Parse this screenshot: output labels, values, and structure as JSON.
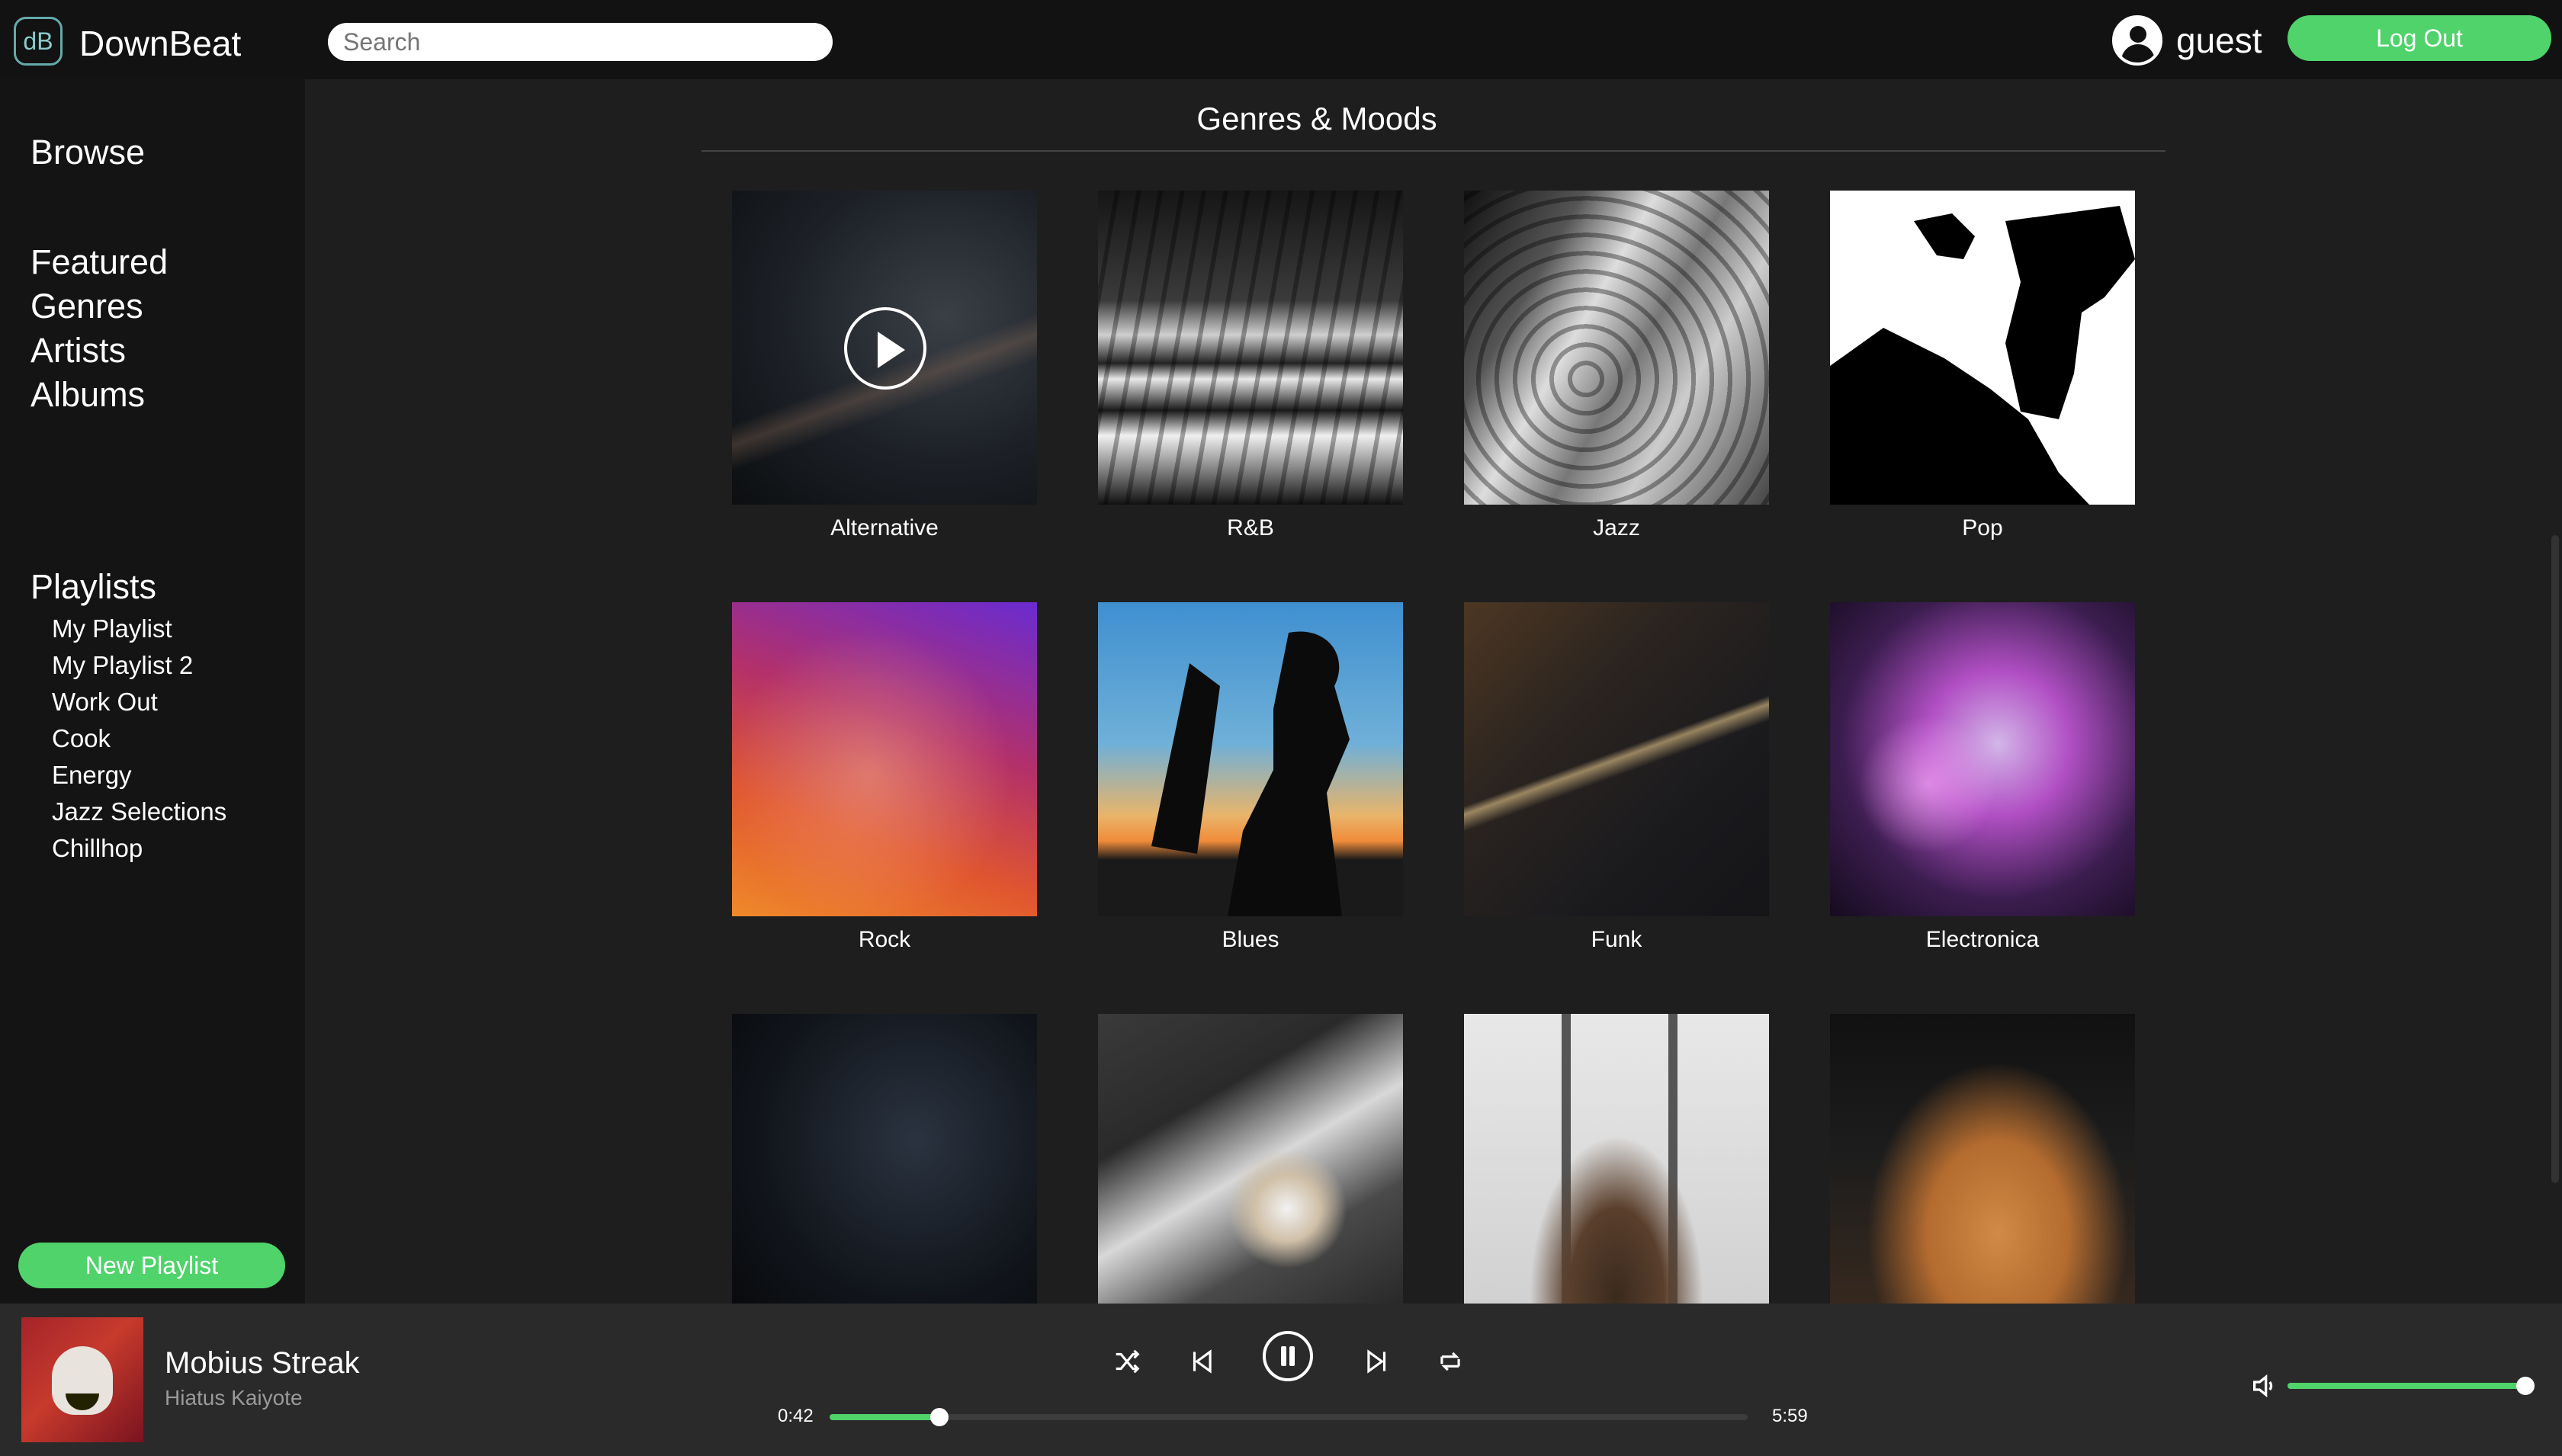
{
  "app": {
    "logo_badge": "dB",
    "name": "DownBeat"
  },
  "search": {
    "placeholder": "Search"
  },
  "user": {
    "name": "guest",
    "logout_label": "Log Out"
  },
  "sidebar": {
    "browse_heading": "Browse",
    "nav": [
      "Featured",
      "Genres",
      "Artists",
      "Albums"
    ],
    "playlists_heading": "Playlists",
    "playlists": [
      "My Playlist",
      "My Playlist 2",
      "Work Out",
      "Cook",
      "Energy",
      "Jazz Selections",
      "Chillhop"
    ],
    "new_playlist_label": "New Playlist"
  },
  "main": {
    "title": "Genres & Moods",
    "tiles": [
      {
        "label": "Alternative",
        "icon": "play-icon"
      },
      {
        "label": "R&B"
      },
      {
        "label": "Jazz"
      },
      {
        "label": "Pop"
      },
      {
        "label": "Rock"
      },
      {
        "label": "Blues"
      },
      {
        "label": "Funk"
      },
      {
        "label": "Electronica"
      },
      {
        "label": ""
      },
      {
        "label": ""
      },
      {
        "label": ""
      },
      {
        "label": ""
      }
    ]
  },
  "player": {
    "track_title": "Mobius Streak",
    "artist": "Hiatus Kaiyote",
    "elapsed": "0:42",
    "duration": "5:59",
    "progress_fraction": 0.12,
    "volume_fraction": 1.0,
    "controls": [
      "shuffle-icon",
      "previous-icon",
      "pause-icon",
      "next-icon",
      "repeat-icon"
    ]
  },
  "colors": {
    "accent": "#4fd36a",
    "topbar": "#121212",
    "sidebar": "#141414",
    "main": "#1e1e1e",
    "player": "#2a2a2a"
  }
}
